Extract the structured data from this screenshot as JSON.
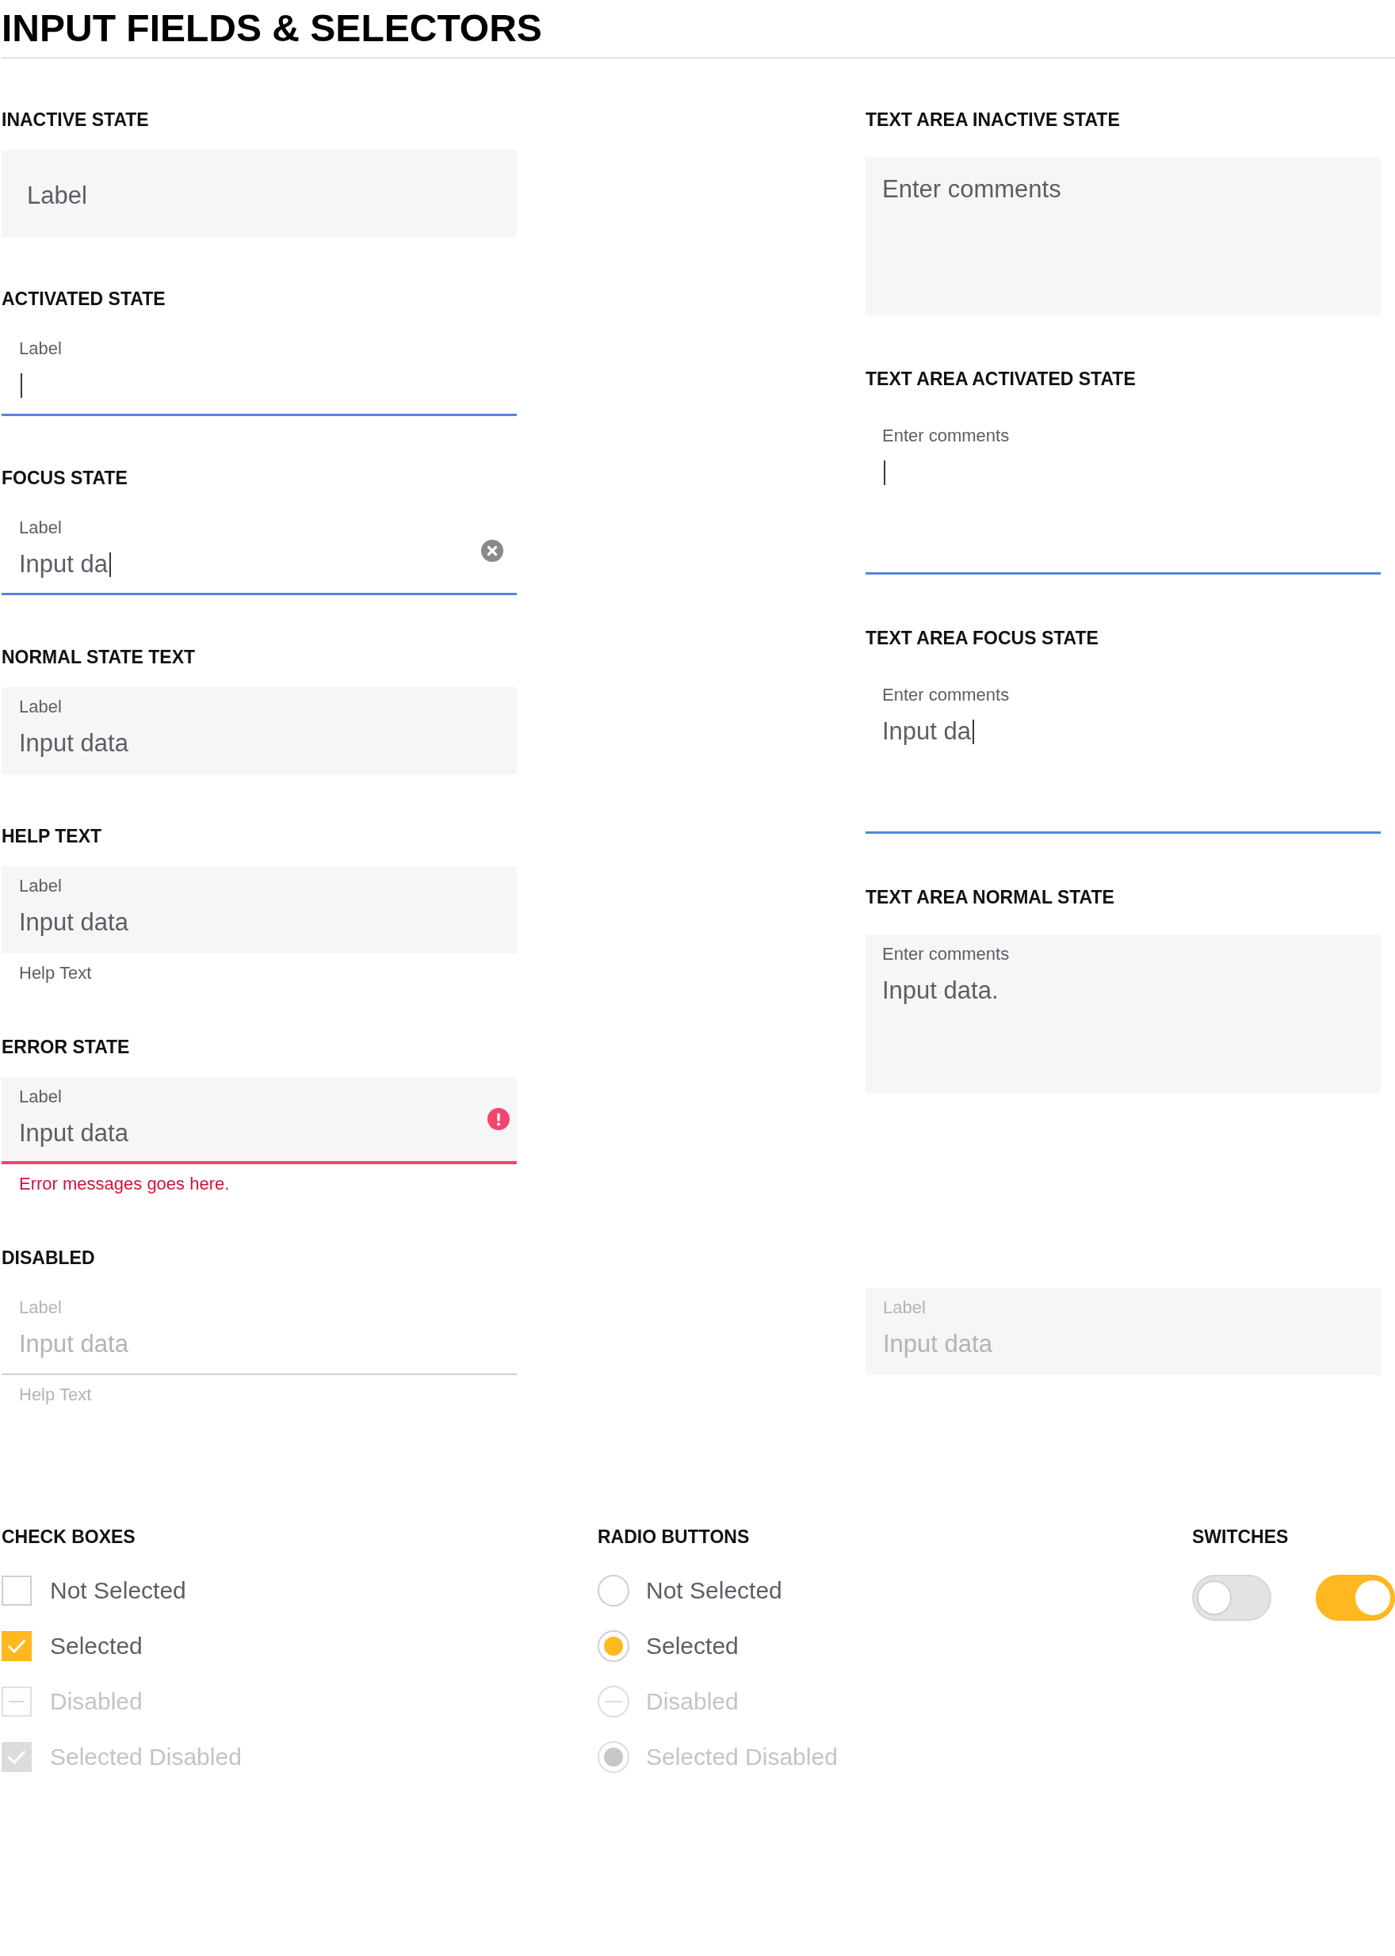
{
  "title": "INPUT FIELDS & SELECTORS",
  "text_fields": [
    {
      "heading": "INACTIVE STATE",
      "kind": "filled",
      "placeholder": "Label",
      "focused": false,
      "invalid": false,
      "caret": false,
      "clear_button": false
    },
    {
      "heading": "ACTIVATED STATE",
      "kind": "underlined",
      "label": "Label",
      "focused": true,
      "invalid": false,
      "caret": true,
      "clear_button": false
    },
    {
      "heading": "FOCUS STATE",
      "kind": "underlined",
      "label": "Label",
      "value": "Input da",
      "focused": true,
      "invalid": false,
      "caret": true,
      "clear_button": true
    },
    {
      "heading": "NORMAL STATE TEXT",
      "kind": "filled",
      "label": "Label",
      "value": "Input data",
      "focused": false,
      "invalid": false,
      "caret": false,
      "clear_button": false
    },
    {
      "heading": "HELP TEXT",
      "kind": "filled",
      "label": "Label",
      "value": "Input data",
      "help": "Help Text",
      "focused": false,
      "invalid": false,
      "caret": false,
      "clear_button": false
    },
    {
      "heading": "ERROR STATE",
      "kind": "filled",
      "label": "Label",
      "value": "Input data",
      "error_message": "Error messages goes here.",
      "focused": false,
      "invalid": true,
      "caret": false,
      "clear_button": false
    }
  ],
  "text_areas": [
    {
      "heading": "TEXT AREA INACTIVE STATE",
      "kind": "filled",
      "placeholder": "Enter comments",
      "focused": false,
      "caret": false
    },
    {
      "heading": "TEXT AREA ACTIVATED STATE",
      "kind": "underlined",
      "label": "Enter comments",
      "focused": true,
      "caret": true
    },
    {
      "heading": "TEXT AREA FOCUS STATE",
      "kind": "underlined",
      "label": "Enter comments",
      "value": "Input da",
      "focused": true,
      "caret": true
    },
    {
      "heading": "TEXT AREA NORMAL STATE",
      "kind": "filled",
      "label": "Enter comments",
      "value": "Input data.",
      "focused": false,
      "caret": false
    }
  ],
  "disabled": {
    "heading": "DISABLED",
    "fields": [
      {
        "kind": "underlined",
        "label": "Label",
        "value": "Input data",
        "help": "Help Text",
        "disabled": true
      },
      {
        "kind": "filled",
        "label": "Label",
        "value": "Input data",
        "disabled": true
      }
    ]
  },
  "checkboxes": {
    "heading": "CHECK BOXES",
    "items": [
      {
        "label": "Not Selected",
        "checked": false,
        "disabled": false
      },
      {
        "label": "Selected",
        "checked": true,
        "disabled": false
      },
      {
        "label": "Disabled",
        "checked": false,
        "disabled": true
      },
      {
        "label": "Selected Disabled",
        "checked": true,
        "disabled": true
      }
    ]
  },
  "radio_buttons": {
    "heading": "RADIO BUTTONS",
    "items": [
      {
        "label": "Not Selected",
        "selected": false,
        "disabled": false
      },
      {
        "label": "Selected",
        "selected": true,
        "disabled": false
      },
      {
        "label": "Disabled",
        "selected": false,
        "disabled": true
      },
      {
        "label": "Selected Disabled",
        "selected": true,
        "disabled": true
      }
    ]
  },
  "switches": {
    "heading": "SWITCHES",
    "items": [
      {
        "on": false
      },
      {
        "on": true
      }
    ]
  }
}
